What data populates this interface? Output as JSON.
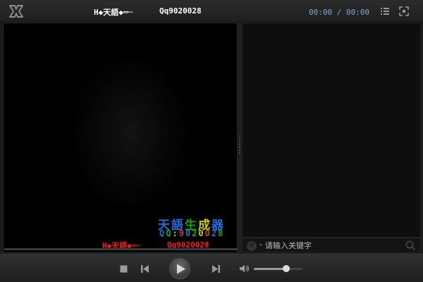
{
  "titlebar": {
    "watermark_text": "H◆天語◆═─",
    "qq": "Qq9020028",
    "time_current": "00:00",
    "time_separator": "/",
    "time_total": "00:00"
  },
  "video_watermark": {
    "title_chars": [
      "天",
      "語",
      "生",
      "成",
      "器"
    ],
    "title_colors": [
      "#2a6bd8",
      "#2a6bd8",
      "#1aa31a",
      "#c8c81a",
      "#2a6bd8"
    ],
    "qq_text": "QQ:9020028",
    "line_text": "H◆天語◆═─",
    "line_qq": "Qq9020028"
  },
  "search": {
    "placeholder": "请输入关键字",
    "value": ""
  },
  "volume": {
    "level": 0.68
  },
  "icons": {
    "logo": "app-logo-icon",
    "playlist": "list-icon",
    "fullscreen": "fullscreen-icon",
    "stop": "stop-icon",
    "prev": "previous-icon",
    "play": "play-icon",
    "next": "next-icon",
    "volume": "speaker-icon",
    "search": "search-icon"
  },
  "colors": {
    "time_text": "#7aa7d9",
    "watermark_red": "#ff1a1a"
  }
}
